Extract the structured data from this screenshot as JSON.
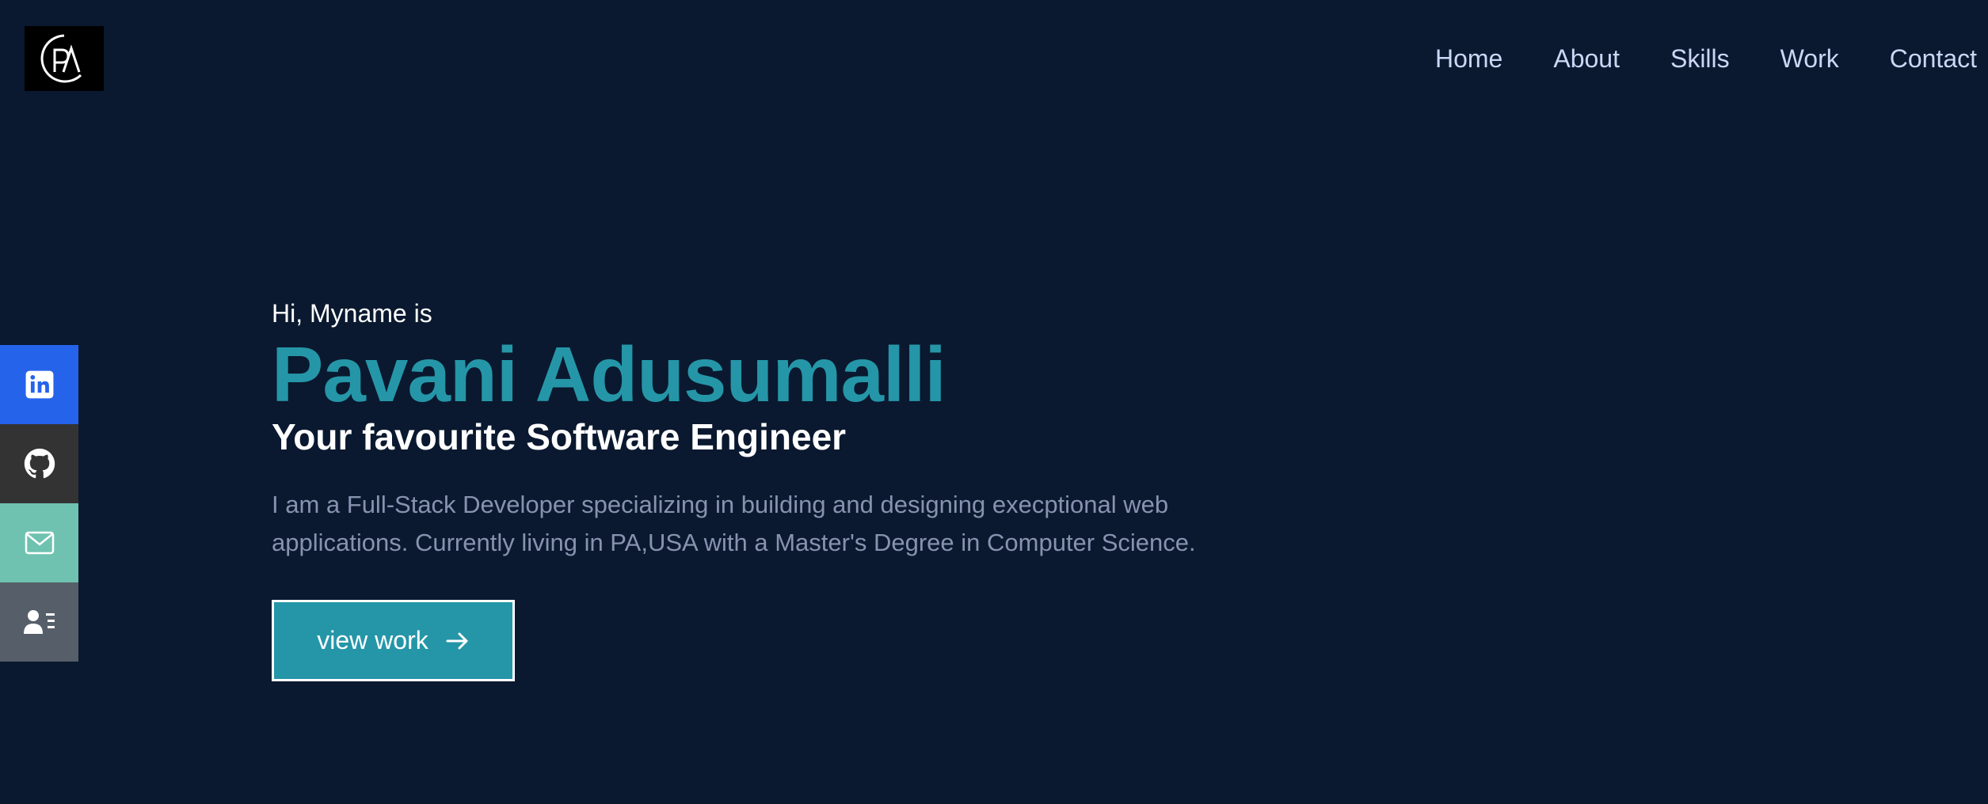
{
  "header": {
    "logo_text": "PA",
    "nav": [
      {
        "label": "Home"
      },
      {
        "label": "About"
      },
      {
        "label": "Skills"
      },
      {
        "label": "Work"
      },
      {
        "label": "Contact"
      }
    ]
  },
  "social": [
    {
      "icon": "linkedin-icon",
      "color": "#2563eb"
    },
    {
      "icon": "github-icon",
      "color": "#333333"
    },
    {
      "icon": "mail-icon",
      "color": "#6fc2b0"
    },
    {
      "icon": "resume-icon",
      "color": "#565f69"
    }
  ],
  "hero": {
    "greeting": "Hi, Myname is",
    "name": "Pavani Adusumalli",
    "role": "Your favourite Software Engineer",
    "bio": "I am a Full-Stack Developer specializing in building and designing execptional web applications. Currently living in PA,USA with a Master's Degree in Computer Science.",
    "button_label": "view work",
    "button_icon": "arrow-right-icon"
  },
  "colors": {
    "background": "#0a192f",
    "accent": "#2596a8",
    "nav_text": "#ccd6f6",
    "muted_text": "#8892b0"
  }
}
